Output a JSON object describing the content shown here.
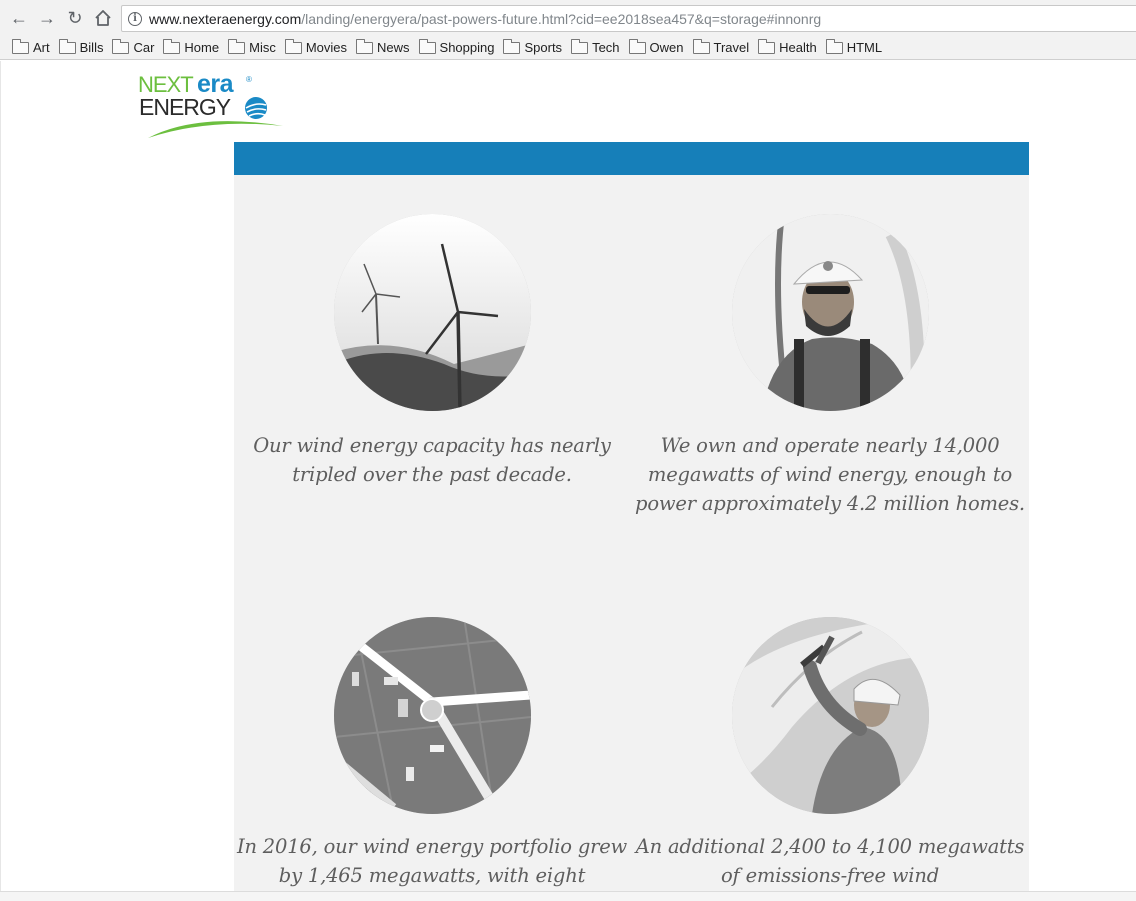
{
  "browser": {
    "url_host": "www.nexteraenergy.com",
    "url_path": "/landing/energyera/past-powers-future.html?cid=ee2018sea457&q=storage#innonrg",
    "bookmarks": [
      "Art",
      "Bills",
      "Car",
      "Home",
      "Misc",
      "Movies",
      "News",
      "Shopping",
      "Sports",
      "Tech",
      "Owen",
      "Travel",
      "Health",
      "HTML"
    ]
  },
  "logo": {
    "next": "NEXT",
    "era": "era",
    "energy": "ENERGY",
    "registered": "®",
    "colors": {
      "green": "#6cbf3f",
      "blue": "#1a8ac6"
    }
  },
  "colors": {
    "banner": "#167fb9",
    "panel": "#f2f2f2",
    "caption_text": "#5e5e5e"
  },
  "cards": [
    {
      "image": "wind-turbines-photo",
      "caption": "Our wind energy capacity has nearly tripled over the past decade."
    },
    {
      "image": "wind-technician-photo",
      "caption": "We own and operate nearly 14,000 megawatts of wind energy, enough to power approximately 4.2 million homes."
    },
    {
      "image": "aerial-turbine-photo",
      "caption": "In 2016, our wind energy portfolio grew by 1,465 megawatts, with eight"
    },
    {
      "image": "technician-blade-photo",
      "caption": "An additional 2,400 to 4,100 megawatts of emissions-free wind"
    }
  ]
}
